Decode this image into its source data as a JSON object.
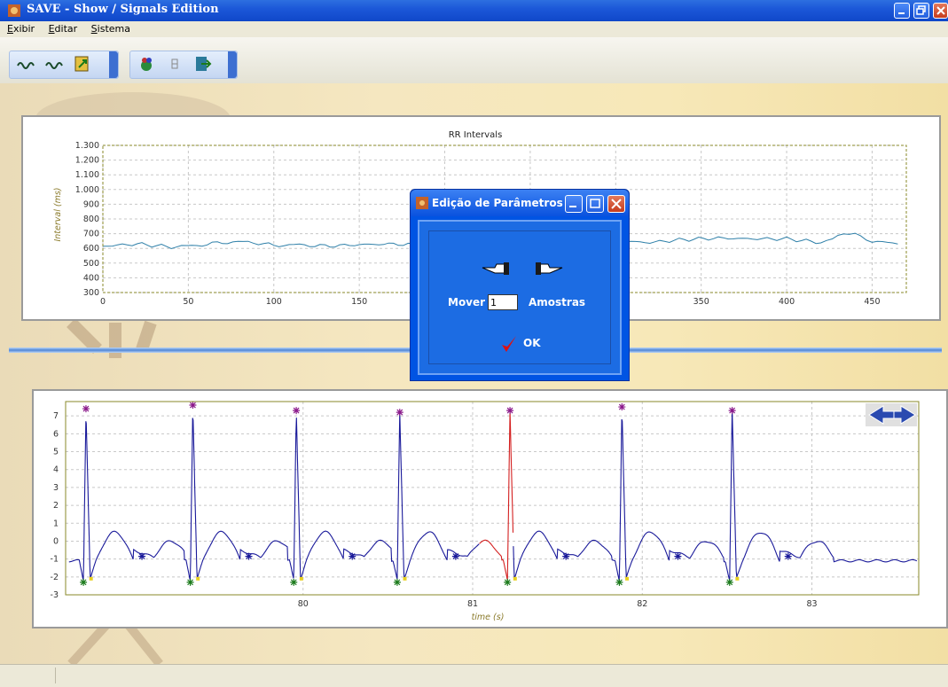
{
  "window": {
    "title": "SAVE - Show / Signals Edition",
    "controls": [
      "minimize",
      "restore",
      "close"
    ]
  },
  "menu": [
    "Exibir",
    "Editar",
    "Sistema"
  ],
  "toolbar": {
    "group1": [
      "signals-icon",
      "signals-icon",
      "export-icon"
    ],
    "group2": [
      "bug-icon",
      "pause-icon",
      "exit-icon"
    ]
  },
  "colors": {
    "titlebar": "#1c58d8",
    "rr_line": "#2d7fa8",
    "ecg_line": "#1a1a9a",
    "ecg_edit": "#d42020",
    "peak_marker": "#8b1a8b",
    "valley_marker": "#1a7a1a",
    "onset_marker": "#e8d020",
    "min_marker": "#1a1a9a",
    "grid": "#bdb56a",
    "frame": "#8a8a2a"
  },
  "rr_chart": {
    "title": "RR Intervals",
    "ylabel": "Interval (ms)",
    "yticks": [
      "1.300",
      "1.200",
      "1.100",
      "1.000",
      "900",
      "800",
      "700",
      "600",
      "500",
      "400",
      "300"
    ],
    "xticks": [
      "0",
      "50",
      "100",
      "150",
      "200",
      "250",
      "300",
      "350",
      "400",
      "450"
    ],
    "xlim": [
      0,
      470
    ],
    "ylim": [
      300,
      1300
    ]
  },
  "ecg_chart": {
    "xlabel": "time (s)",
    "xticks": [
      "80",
      "81",
      "82",
      "83"
    ],
    "yticks": [
      "7",
      "6",
      "5",
      "4",
      "3",
      "2",
      "1",
      "0",
      "-1",
      "-2",
      "-3"
    ],
    "xlim": [
      78.6,
      83.63
    ],
    "ylim": [
      -3,
      7.8
    ]
  },
  "chart_data": [
    {
      "type": "line",
      "title": "RR Intervals",
      "xlabel": "",
      "ylabel": "Interval (ms)",
      "xlim": [
        0,
        470
      ],
      "ylim": [
        300,
        1300
      ],
      "grid": true,
      "series": [
        {
          "x": [
            0,
            20,
            40,
            55,
            70,
            85,
            100,
            115,
            130,
            150,
            170,
            190,
            210,
            240,
            270,
            300,
            320,
            340,
            360,
            380,
            400,
            420,
            430,
            440,
            450,
            465
          ],
          "y": [
            615,
            630,
            610,
            620,
            640,
            645,
            620,
            625,
            615,
            625,
            630,
            620,
            625,
            640,
            635,
            650,
            640,
            660,
            670,
            665,
            665,
            640,
            680,
            700,
            650,
            630
          ]
        }
      ]
    },
    {
      "type": "line",
      "title": "",
      "xlabel": "time (s)",
      "ylabel": "",
      "xlim": [
        78.6,
        83.63
      ],
      "ylim": [
        -3,
        7.8
      ],
      "grid": true,
      "series": [
        {
          "name": "",
          "x": [
            78.62,
            78.66,
            78.69,
            78.7,
            78.72,
            78.75,
            78.78,
            78.85,
            78.9,
            78.95,
            79.0,
            79.1,
            79.15,
            79.25,
            79.3,
            79.35,
            79.42,
            79.5,
            79.6,
            79.65,
            79.7,
            79.75,
            79.77,
            79.8,
            79.9,
            80.0,
            80.1,
            80.15,
            80.2,
            80.3,
            80.35,
            80.4,
            80.41,
            80.44,
            80.46,
            80.5,
            80.6,
            80.65,
            80.7,
            80.8,
            80.9,
            80.96,
            81.0,
            81.05,
            81.06
          ],
          "y": [
            -1.2,
            -1.3,
            -2.3,
            0,
            7.4,
            0,
            -2.1,
            -1.7,
            -0.5,
            0.5,
            -0.3,
            -0.7,
            -0.6,
            0.2,
            -0.5,
            -2.1,
            7.6,
            0,
            -1.8,
            -1.1,
            0.3,
            -0.3,
            -0.9,
            -0.8,
            0.5,
            -0.2,
            -0.8,
            -2.3,
            7.3,
            0,
            -2.2,
            -0.5,
            0.3,
            -0.3,
            -1.3,
            -1.1,
            -0.6,
            0.5,
            -0.3,
            -1.2,
            -1.2,
            -2.6,
            7.2,
            0,
            -2.4
          ]
        }
      ]
    }
  ],
  "dialog": {
    "title": "Edição de Parâmetros",
    "move_label": "Mover",
    "move_value": "1",
    "units_label": "Amostras",
    "ok_label": "OK",
    "left_icon": "pointing-left-hand-icon",
    "right_icon": "pointing-right-hand-icon"
  },
  "nav_arrows": [
    "arrow-left-icon",
    "arrow-right-icon"
  ]
}
